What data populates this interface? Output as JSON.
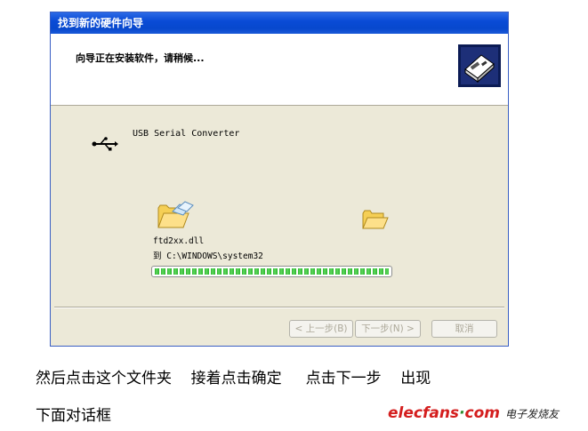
{
  "dialog": {
    "title": "找到新的硬件向导",
    "header_text": "向导正在安装软件，请稍候...",
    "device_name": "USB Serial Converter",
    "file_name": "ftd2xx.dll",
    "dest_path": "到 C:\\WINDOWS\\system32",
    "progress": 1.0,
    "buttons": {
      "back": "< 上一步(B)",
      "next": "下一步(N) >",
      "cancel": "取消"
    }
  },
  "caption": {
    "line1": "然后点击这个文件夹    接着点击确定     点击下一步    出现",
    "line2": "下面对话框"
  },
  "watermark": {
    "brand": "elecfans",
    "dot": "·",
    "tld": "com",
    "tagline": "电子发烧友"
  },
  "colors": {
    "titlebar": "#0a4bd6",
    "progress": "#2bb32b",
    "window_bg": "#ece9d8",
    "logo": "#d41e1e"
  }
}
